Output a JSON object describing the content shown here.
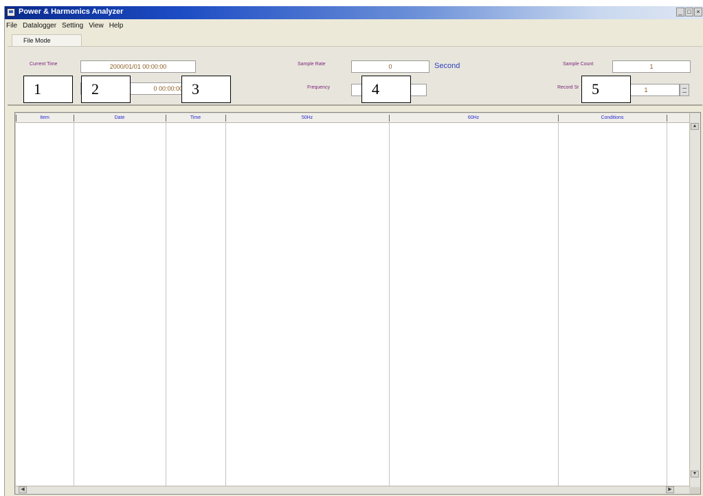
{
  "window": {
    "title": "Power & Harmonics Analyzer",
    "min_label": "_",
    "max_label": "□",
    "close_label": "×"
  },
  "menu": {
    "items": [
      "File",
      "Datalogger",
      "Setting",
      "View",
      "Help"
    ]
  },
  "tabs": {
    "active": "File Mode"
  },
  "fields": {
    "current_time_label": "Current Time",
    "current_time_value": "2000/01/01 00:00:00",
    "row2_value": "0 00:00:00",
    "sample_rate_label": "Sample Rate",
    "sample_rate_value": "0",
    "sample_rate_unit": "Second",
    "frequency_label": "Frequency",
    "frequency_value": "",
    "sample_count_label": "Sample Count",
    "sample_count_value": "1",
    "record_label": "Record Sr",
    "record_value": "1"
  },
  "callouts": [
    "1",
    "2",
    "3",
    "4",
    "5"
  ],
  "table": {
    "columns": [
      "Item",
      "Date",
      "Time",
      "50Hz",
      "60Hz",
      "Conditions"
    ]
  },
  "scroll": {
    "up": "▲",
    "down": "▼",
    "left": "◀",
    "right": "▶"
  }
}
